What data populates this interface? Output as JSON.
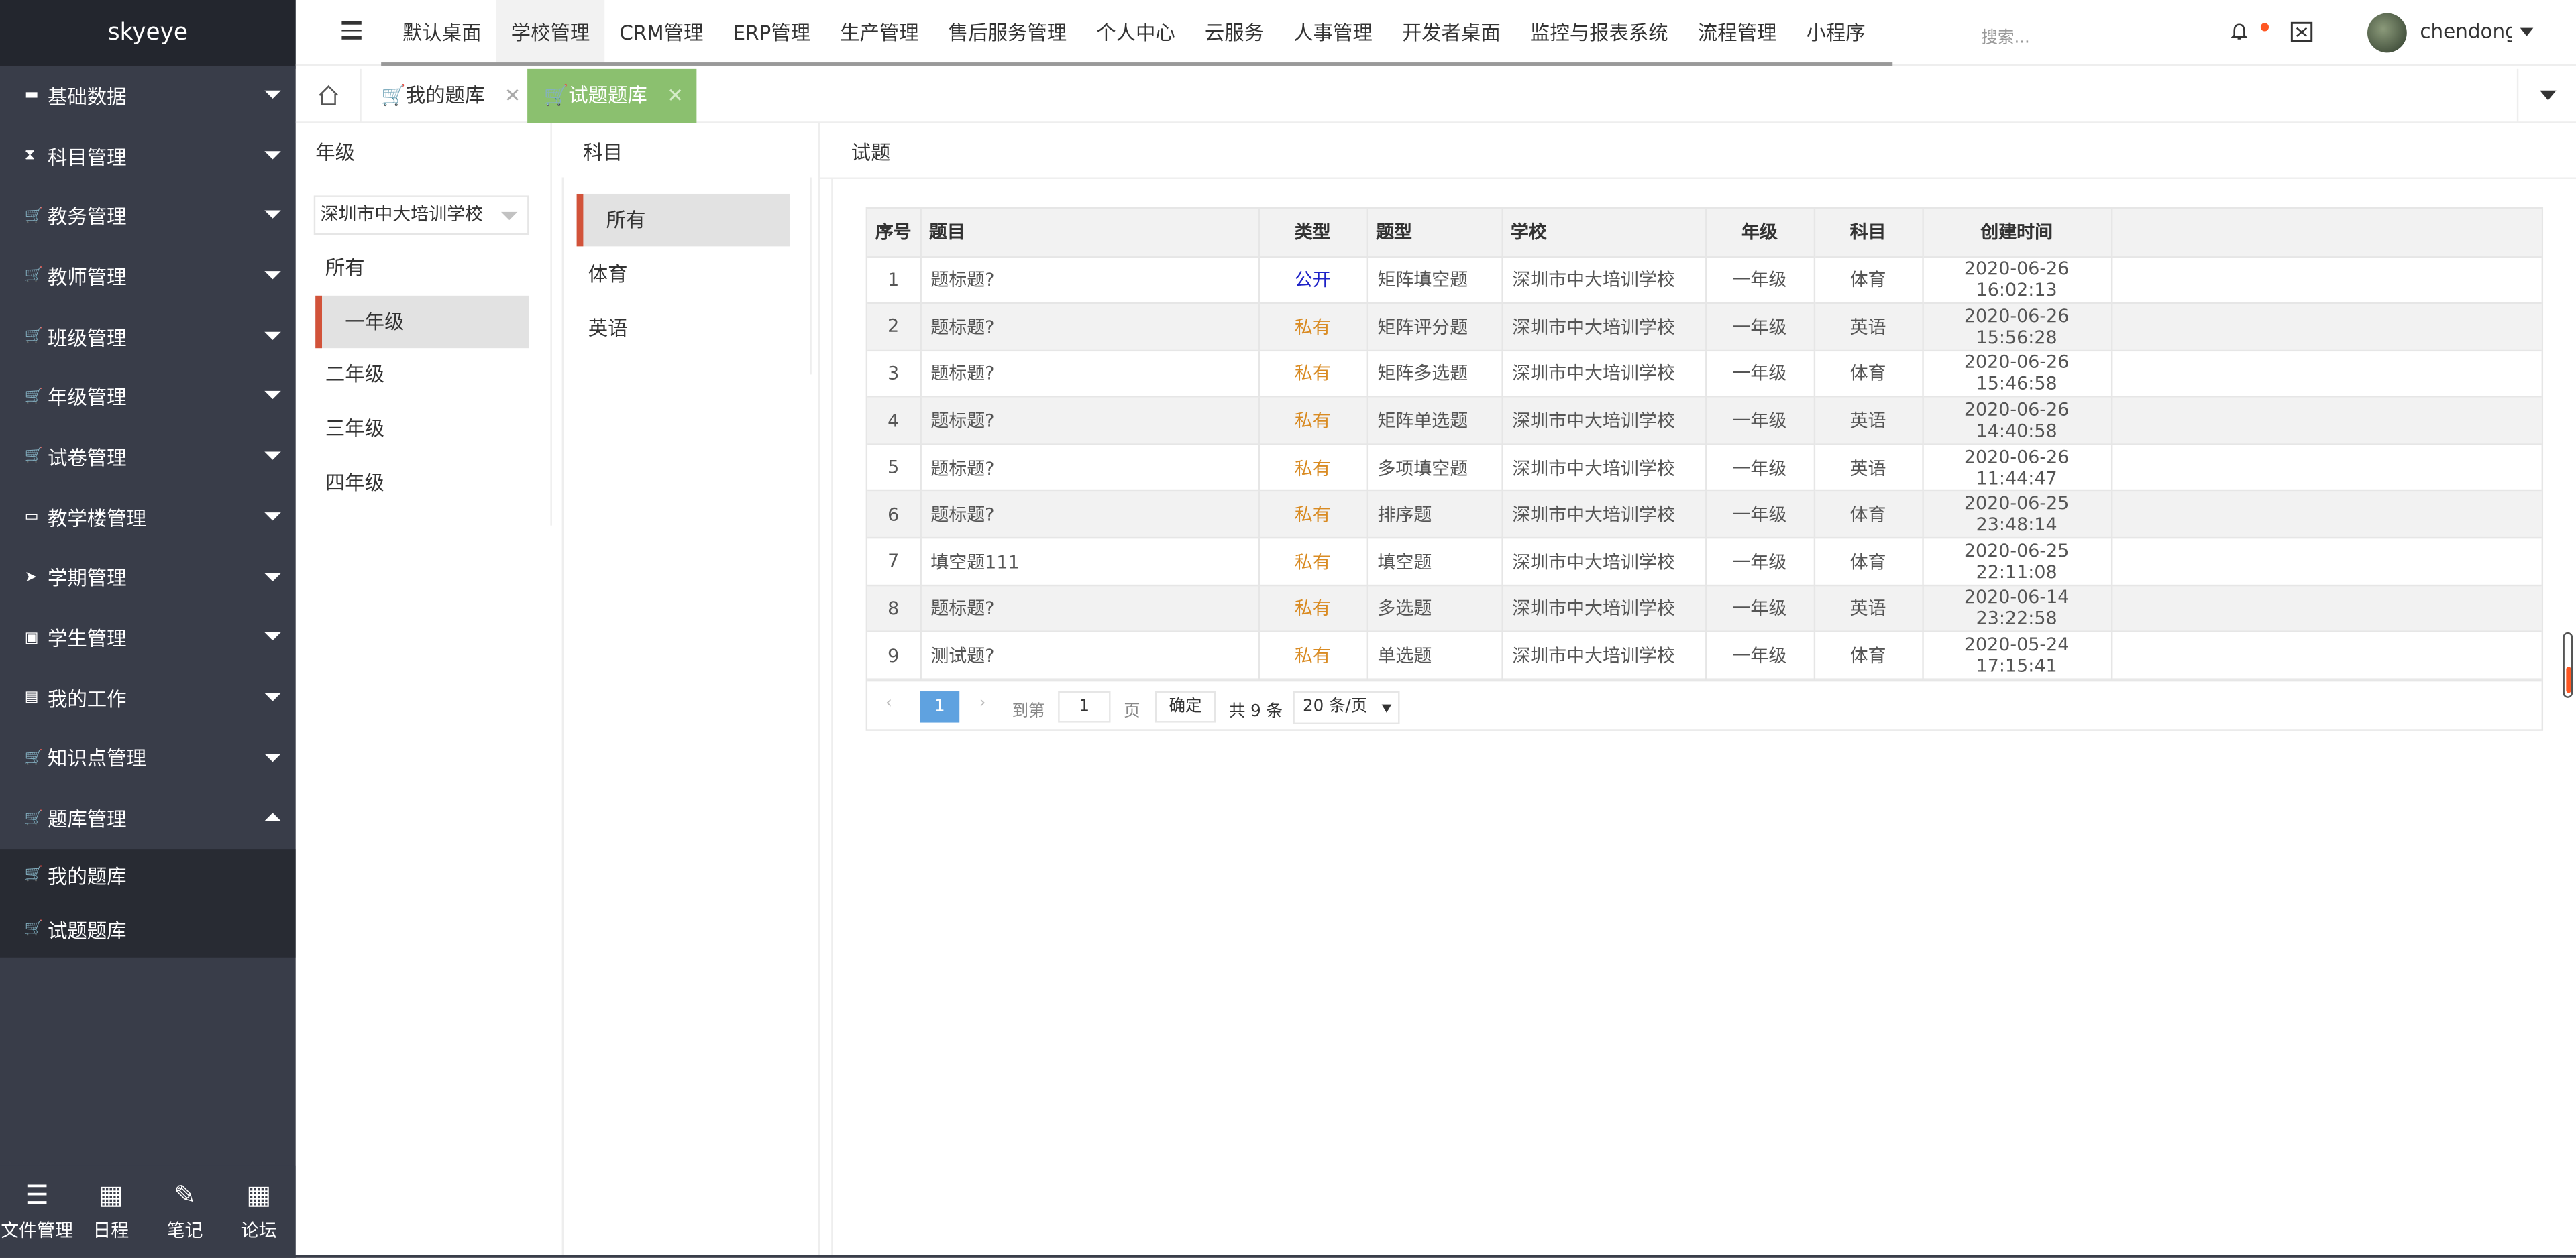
{
  "app": {
    "brand": "skyeye"
  },
  "sidebar": {
    "items": [
      {
        "label": "基础数据",
        "icon": "folder-icon"
      },
      {
        "label": "科目管理",
        "icon": "hourglass-icon"
      },
      {
        "label": "教务管理",
        "icon": "cart-icon"
      },
      {
        "label": "教师管理",
        "icon": "cart-icon"
      },
      {
        "label": "班级管理",
        "icon": "cart-icon"
      },
      {
        "label": "年级管理",
        "icon": "cart-icon"
      },
      {
        "label": "试卷管理",
        "icon": "cart-icon"
      },
      {
        "label": "教学楼管理",
        "icon": "folder-open-icon"
      },
      {
        "label": "学期管理",
        "icon": "send-icon"
      },
      {
        "label": "学生管理",
        "icon": "id-card-icon"
      },
      {
        "label": "我的工作",
        "icon": "archive-icon"
      },
      {
        "label": "知识点管理",
        "icon": "cart-icon"
      },
      {
        "label": "题库管理",
        "icon": "cart-icon"
      }
    ],
    "submenu": [
      {
        "label": "我的题库",
        "icon": "cart-icon"
      },
      {
        "label": "试题题库",
        "icon": "cart-icon"
      }
    ],
    "bottom": [
      {
        "label": "文件管理",
        "icon": "list-icon"
      },
      {
        "label": "日程",
        "icon": "calendar-icon"
      },
      {
        "label": "笔记",
        "icon": "edit-icon"
      },
      {
        "label": "论坛",
        "icon": "calendar-icon"
      }
    ]
  },
  "topnav": {
    "items": [
      "默认桌面",
      "学校管理",
      "CRM管理",
      "ERP管理",
      "生产管理",
      "售后服务管理",
      "个人中心",
      "云服务",
      "人事管理",
      "开发者桌面",
      "监控与报表系统",
      "流程管理",
      "小程序"
    ],
    "active_index": 1,
    "search_placeholder": "搜索...",
    "username": "chendonggua"
  },
  "tabs": [
    {
      "label": "我的题库",
      "close": "✕",
      "active": false
    },
    {
      "label": "试题题库",
      "close": "✕",
      "active": true
    }
  ],
  "panels": {
    "grade_title": "年级",
    "subject_title": "科目",
    "question_title": "试题",
    "school_select": "深圳市中大培训学校",
    "grades": [
      "所有",
      "一年级",
      "二年级",
      "三年级",
      "四年级"
    ],
    "grade_selected": 1,
    "subjects": [
      "所有",
      "体育",
      "英语"
    ],
    "subject_selected": 0
  },
  "table": {
    "headers": [
      "序号",
      "题目",
      "类型",
      "题型",
      "学校",
      "年级",
      "科目",
      "创建时间"
    ],
    "rows": [
      [
        "1",
        "题标题?",
        "公开",
        "矩阵填空题",
        "深圳市中大培训学校",
        "一年级",
        "体育",
        "2020-06-26 16:02:13"
      ],
      [
        "2",
        "题标题?",
        "私有",
        "矩阵评分题",
        "深圳市中大培训学校",
        "一年级",
        "英语",
        "2020-06-26 15:56:28"
      ],
      [
        "3",
        "题标题?",
        "私有",
        "矩阵多选题",
        "深圳市中大培训学校",
        "一年级",
        "体育",
        "2020-06-26 15:46:58"
      ],
      [
        "4",
        "题标题?",
        "私有",
        "矩阵单选题",
        "深圳市中大培训学校",
        "一年级",
        "英语",
        "2020-06-26 14:40:58"
      ],
      [
        "5",
        "题标题?",
        "私有",
        "多项填空题",
        "深圳市中大培训学校",
        "一年级",
        "英语",
        "2020-06-26 11:44:47"
      ],
      [
        "6",
        "题标题?",
        "私有",
        "排序题",
        "深圳市中大培训学校",
        "一年级",
        "体育",
        "2020-06-25 23:48:14"
      ],
      [
        "7",
        "填空题111",
        "私有",
        "填空题",
        "深圳市中大培训学校",
        "一年级",
        "体育",
        "2020-06-25 22:11:08"
      ],
      [
        "8",
        "题标题?",
        "私有",
        "多选题",
        "深圳市中大培训学校",
        "一年级",
        "英语",
        "2020-06-14 23:22:58"
      ],
      [
        "9",
        "测试题?",
        "私有",
        "单选题",
        "深圳市中大培训学校",
        "一年级",
        "体育",
        "2020-05-24 17:15:41"
      ]
    ]
  },
  "pager": {
    "prev": "‹",
    "current": "1",
    "next": "›",
    "goto_label": "到第",
    "page_input": "1",
    "page_word": "页",
    "confirm": "确定",
    "total": "共 9 条",
    "page_size": "20 条/页"
  },
  "colors": {
    "sidebar_bg": "#393d49",
    "active_tab": "#8bc06f",
    "selected_marker": "#d2533a",
    "public_text": "#1e22c7",
    "private_text": "#d98b23",
    "pager_current": "#5fa2e0"
  }
}
